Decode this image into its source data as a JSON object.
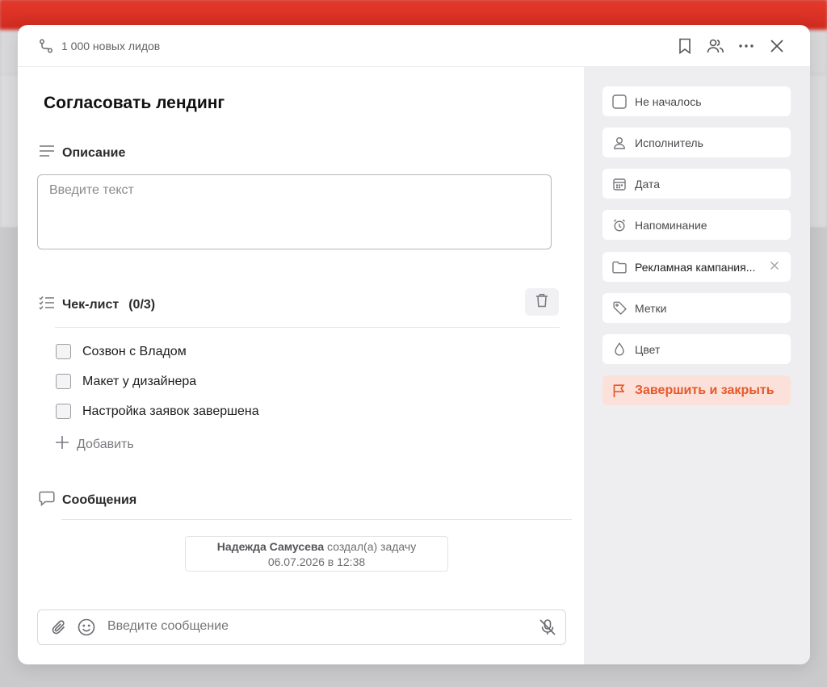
{
  "header": {
    "project_label": "1 000 новых лидов"
  },
  "task": {
    "title": "Согласовать лендинг"
  },
  "description": {
    "heading": "Описание",
    "placeholder": "Введите текст"
  },
  "checklist": {
    "heading": "Чек-лист",
    "count": "(0/3)",
    "items": [
      {
        "label": "Созвон с Владом"
      },
      {
        "label": "Макет у дизайнера"
      },
      {
        "label": "Настройка заявок завершена"
      }
    ],
    "add_label": "Добавить"
  },
  "messages": {
    "heading": "Сообщения",
    "event": {
      "author": "Надежда Самусева",
      "action": "создал(а) задачу",
      "timestamp": "06.07.2026 в 12:38"
    }
  },
  "composer": {
    "placeholder": "Введите сообщение"
  },
  "sidebar": {
    "status": "Не началось",
    "assignee": "Исполнитель",
    "date": "Дата",
    "reminder": "Напоминание",
    "project": "Рекламная кампания...",
    "tags": "Метки",
    "color": "Цвет",
    "finish": "Завершить и закрыть"
  },
  "colors": {
    "accent": "#e8572a",
    "accent_bg": "#fbe1d9",
    "brand_red": "#d93226",
    "sidebar_bg": "#eeeef0"
  },
  "icons": [
    "route-icon",
    "bookmark-icon",
    "users-icon",
    "more-icon",
    "close-icon",
    "description-icon",
    "checklist-icon",
    "trash-icon",
    "plus-icon",
    "message-icon",
    "paperclip-icon",
    "emoji-icon",
    "mic-off-icon",
    "user-icon",
    "calendar-icon",
    "alarm-icon",
    "folder-icon",
    "tag-icon",
    "drop-icon",
    "flag-icon"
  ]
}
